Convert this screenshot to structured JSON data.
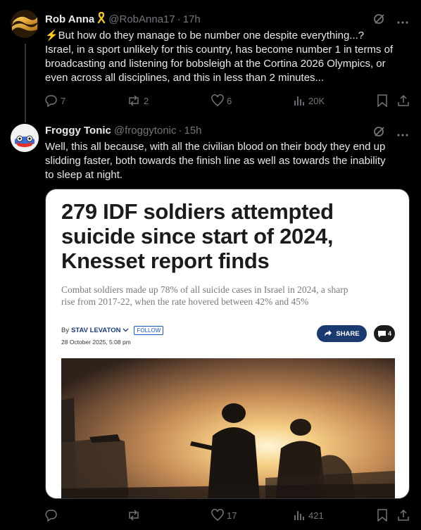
{
  "tweet1": {
    "name": "Rob Anna",
    "handle": "@RobAnna17",
    "time": "17h",
    "text_line1": "⚡But how do they manage to be number one despite everything...?",
    "text_line2": "Israel, in a sport unlikely for this country, has become number 1 in terms of",
    "text_line3": "broadcasting and listening for bobsleigh at the Cortina 2026 Olympics, or",
    "text_line4": "even across all disciplines, and this in less than 2 minutes...",
    "replies": "7",
    "reposts": "2",
    "likes": "6",
    "views": "20K"
  },
  "tweet2": {
    "name": "Froggy Tonic",
    "handle": "@froggytonic",
    "time": "15h",
    "text_line1": "Well, this all because, with all the civilian blood on their body they end up",
    "text_line2": "slidding faster, both towards the finish line as well as towards the inability",
    "text_line3": "to sleep at night.",
    "replies": "",
    "reposts": "",
    "likes": "17",
    "views": "421",
    "card": {
      "title_line1": "279 IDF soldiers attempted",
      "title_line2": "suicide since start of 2024,",
      "title_line3": "Knesset report finds",
      "sub_line1": "Combat soldiers made up 78% of all suicide cases in Israel in 2024, a sharp",
      "sub_line2": "rise from 2017-22, when the rate hovered between 42% and 45%",
      "by": "By",
      "author": "STAV LEVATON",
      "follow": "FOLLOW",
      "date": "28 October 2025, 5:08 pm",
      "share": "SHARE",
      "comments": "4"
    }
  },
  "colors": {
    "background": "#000000",
    "text": "#e7e9ea",
    "muted": "#71767b",
    "divider": "#333639",
    "article_blue": "#1a3a70"
  }
}
